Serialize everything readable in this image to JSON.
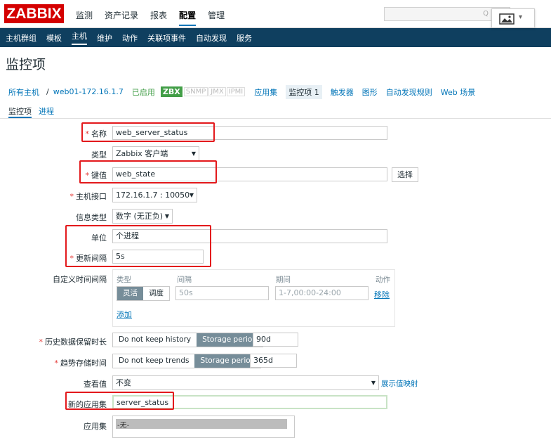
{
  "topmenu": [
    "监测",
    "资产记录",
    "报表",
    "配置",
    "管理"
  ],
  "logo": "ZABBIX",
  "submenu": [
    "主机群组",
    "模板",
    "主机",
    "维护",
    "动作",
    "关联项事件",
    "自动发现",
    "服务"
  ],
  "page_title": "监控项",
  "breadcrumb": {
    "all_hosts": "所有主机",
    "sep": "/",
    "host": "web01-172.16.1.7",
    "enabled": "已启用",
    "zbx": "ZBX",
    "snmp": "SNMP",
    "jmx": "JMX",
    "ipmi": "IPMI",
    "tabs": [
      "应用集",
      "监控项 1",
      "触发器",
      "图形",
      "自动发现规则",
      "Web 场景"
    ]
  },
  "tabs": [
    "监控项",
    "进程"
  ],
  "form": {
    "name_label": "名称",
    "name_value": "web_server_status",
    "type_label": "类型",
    "type_value": "Zabbix 客户端",
    "key_label": "键值",
    "key_value": "web_state",
    "key_select": "选择",
    "iface_label": "主机接口",
    "iface_value": "172.16.1.7 : 10050",
    "info_label": "信息类型",
    "info_value": "数字 (无正负)",
    "unit_label": "单位",
    "unit_value": "个进程",
    "interval_label": "更新间隔",
    "interval_value": "5s",
    "custom_label": "自定义时间间隔",
    "custom": {
      "h_type": "类型",
      "h_interval": "间隔",
      "h_period": "期间",
      "h_action": "动作",
      "flexible": "灵活",
      "scheduling": "调度",
      "interval_ph": "50s",
      "period_ph": "1-7,00:00-24:00",
      "remove": "移除",
      "add": "添加"
    },
    "history_label": "历史数据保留时长",
    "history_no": "Do not keep history",
    "history_period": "Storage period",
    "history_value": "90d",
    "trends_label": "趋势存储时间",
    "trends_no": "Do not keep trends",
    "trends_period": "Storage period",
    "trends_value": "365d",
    "show_label": "查看值",
    "show_value": "不变",
    "show_mapping": "展示值映射",
    "newapp_label": "新的应用集",
    "newapp_value": "server_status",
    "apps_label": "应用集",
    "apps_option": "-无-"
  },
  "colors": {
    "brand": "#d40000",
    "nav": "#0f3f5f",
    "highlight": "#e3191c",
    "link": "#0275b8",
    "green": "#429e47"
  }
}
